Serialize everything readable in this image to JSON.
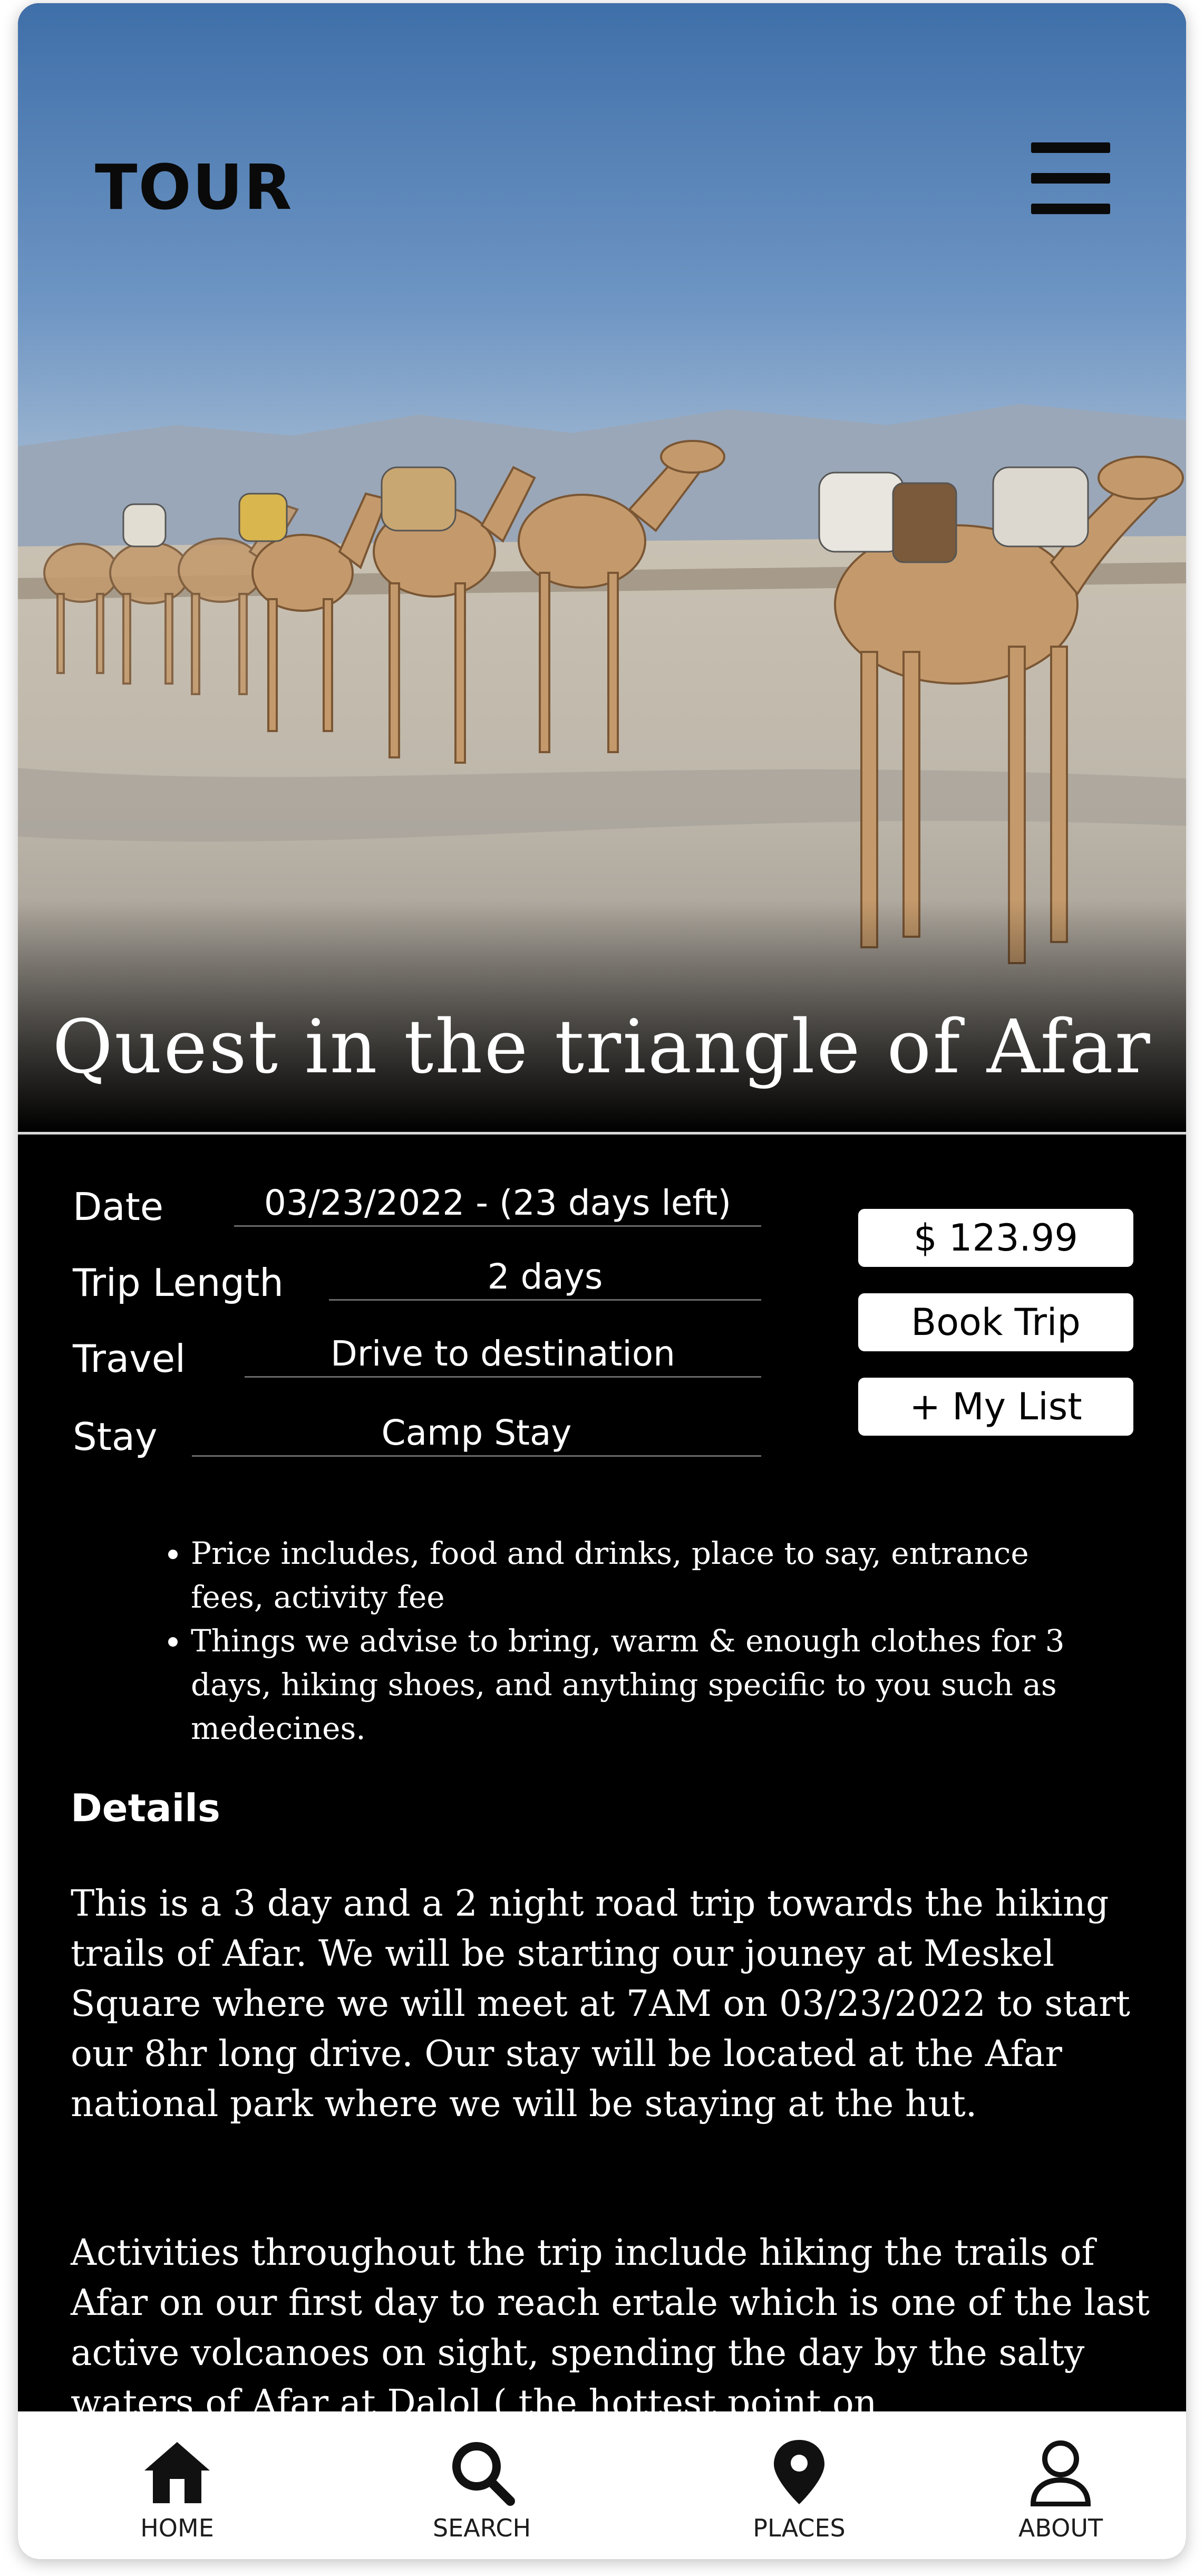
{
  "header": {
    "brand": "TOUR",
    "menu_icon": "hamburger-menu-icon"
  },
  "hero": {
    "image_subject": "camel caravan on salt flats",
    "title": "Quest in the triangle of Afar"
  },
  "trip": {
    "date_label": "Date",
    "date_value": "03/23/2022 -  (23 days left)",
    "length_label": "Trip Length",
    "length_value": "2 days",
    "travel_label": "Travel",
    "travel_value": "Drive to destination",
    "stay_label": "Stay",
    "stay_value": "Camp Stay"
  },
  "actions": {
    "price": "$ 123.99",
    "book": "Book Trip",
    "my_list": "+ My List"
  },
  "notes": [
    "Price includes, food and drinks, place to say, entrance fees, activity fee",
    "Things we advise to bring, warm & enough clothes for 3 days, hiking shoes, and anything specific to you such as medecines."
  ],
  "details": {
    "heading": "Details",
    "paragraphs": [
      "This is a 3 day and a 2 night road trip towards the hiking trails of Afar. We will be starting our jouney at Meskel Square where we will meet at 7AM on 03/23/2022 to start our 8hr long drive. Our stay will be located at the Afar national park where we will be staying at the hut.",
      "Activities throughout the trip include hiking the trails of Afar on our first day to reach ertale which is one of the last active volcanoes on sight, spending the day by the salty waters of Afar at Dalol ( the hottest point on"
    ]
  },
  "bottom_nav": [
    {
      "label": "HOME",
      "icon": "home-icon"
    },
    {
      "label": "SEARCH",
      "icon": "search-icon"
    },
    {
      "label": "PLACES",
      "icon": "map-pin-icon"
    },
    {
      "label": "ABOUT",
      "icon": "user-icon"
    }
  ],
  "colors": {
    "background": "#000000",
    "text": "#ffffff",
    "button_bg": "#ffffff",
    "sky": "#4f7fb6"
  }
}
